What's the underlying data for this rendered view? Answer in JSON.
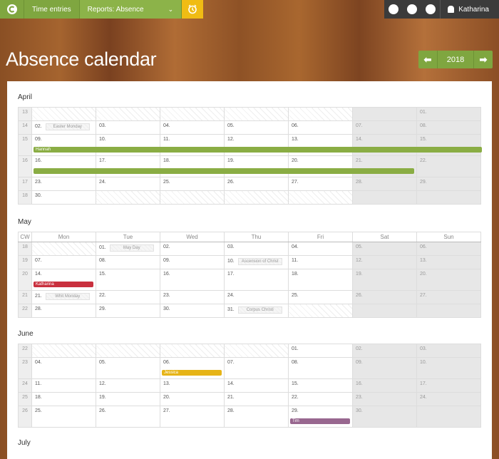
{
  "nav": {
    "time_entries": "Time entries",
    "reports": "Reports: Absence",
    "user": "Katharina",
    "chevron": "⌄",
    "clock": "⏰"
  },
  "page": {
    "title": "Absence calendar",
    "year": "2018",
    "prev": "⬅",
    "next": "➡"
  },
  "weekdays": [
    "CW",
    "Mon",
    "Tue",
    "Wed",
    "Thu",
    "Fri",
    "Sat",
    "Sun"
  ],
  "months": [
    {
      "name": "April",
      "headers": false,
      "rows": [
        {
          "cw": "13",
          "days": [
            "",
            "",
            "",
            "",
            "",
            "",
            "01."
          ],
          "off": [
            1,
            1,
            1,
            1,
            1,
            0,
            0
          ]
        },
        {
          "cw": "14",
          "days": [
            "02.",
            "03.",
            "04.",
            "05.",
            "06.",
            "07.",
            "08."
          ],
          "hol": {
            "0": "Easter Monday"
          }
        },
        {
          "cw": "15",
          "days": [
            "09.",
            "10.",
            "11.",
            "12.",
            "13.",
            "14.",
            "15."
          ],
          "tall": true
        },
        {
          "cw": "16",
          "days": [
            "16.",
            "17.",
            "18.",
            "19.",
            "20.",
            "21.",
            "22."
          ],
          "tall": true
        },
        {
          "cw": "17",
          "days": [
            "23.",
            "24.",
            "25.",
            "26.",
            "27.",
            "28.",
            "29."
          ]
        },
        {
          "cw": "18",
          "days": [
            "30.",
            "",
            "",
            "",
            "",
            "",
            ""
          ],
          "off": [
            0,
            1,
            1,
            1,
            1,
            0,
            0
          ]
        }
      ],
      "bars": [
        {
          "label": "Hannah",
          "color": "#8aad44",
          "row": 2,
          "from": 0,
          "to": 7
        },
        {
          "label": "",
          "color": "#8aad44",
          "row": 3,
          "from": 0,
          "to": 6
        }
      ]
    },
    {
      "name": "May",
      "headers": true,
      "rows": [
        {
          "cw": "18",
          "days": [
            "",
            "01.",
            "02.",
            "03.",
            "04.",
            "05.",
            "06."
          ],
          "off": [
            1,
            0,
            0,
            0,
            0,
            0,
            0
          ],
          "hol": {
            "1": "May Day"
          }
        },
        {
          "cw": "19",
          "days": [
            "07.",
            "08.",
            "09.",
            "10.",
            "11.",
            "12.",
            "13."
          ],
          "hol": {
            "3": "Ascension of Christ"
          }
        },
        {
          "cw": "20",
          "days": [
            "14.",
            "15.",
            "16.",
            "17.",
            "18.",
            "19.",
            "20."
          ],
          "tall": true
        },
        {
          "cw": "21",
          "days": [
            "21.",
            "22.",
            "23.",
            "24.",
            "25.",
            "26.",
            "27."
          ],
          "hol": {
            "0": "Whit Monday"
          }
        },
        {
          "cw": "22",
          "days": [
            "28.",
            "29.",
            "30.",
            "31.",
            "",
            "",
            ""
          ],
          "off": [
            0,
            0,
            0,
            0,
            1,
            0,
            0
          ],
          "hol": {
            "3": "Corpus Christi"
          }
        }
      ],
      "bars": [
        {
          "label": "Katharina",
          "color": "#c9303e",
          "row": 2,
          "from": 0,
          "to": 1
        }
      ]
    },
    {
      "name": "June",
      "headers": false,
      "rows": [
        {
          "cw": "22",
          "days": [
            "",
            "",
            "",
            "",
            "01.",
            "02.",
            "03."
          ],
          "off": [
            1,
            1,
            1,
            1,
            0,
            0,
            0
          ]
        },
        {
          "cw": "23",
          "days": [
            "04.",
            "05.",
            "06.",
            "07.",
            "08.",
            "09.",
            "10."
          ],
          "tall": true
        },
        {
          "cw": "24",
          "days": [
            "11.",
            "12.",
            "13.",
            "14.",
            "15.",
            "16.",
            "17."
          ]
        },
        {
          "cw": "25",
          "days": [
            "18.",
            "19.",
            "20.",
            "21.",
            "22.",
            "23.",
            "24."
          ]
        },
        {
          "cw": "26",
          "days": [
            "25.",
            "26.",
            "27.",
            "28.",
            "29.",
            "30.",
            ""
          ],
          "tall": true
        }
      ],
      "bars": [
        {
          "label": "Jessica",
          "color": "#e6b417",
          "row": 1,
          "from": 2,
          "to": 3
        },
        {
          "label": "Tim",
          "color": "#98678f",
          "row": 4,
          "from": 4,
          "to": 5
        }
      ]
    },
    {
      "name": "July",
      "headers": false,
      "rows": [],
      "bars": []
    }
  ]
}
